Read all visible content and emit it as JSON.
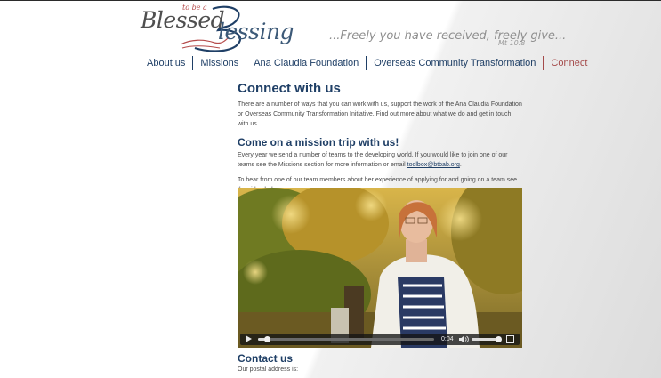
{
  "logo": {
    "word1": "Blessed",
    "small": "to be a",
    "word2": "lessing"
  },
  "tagline": {
    "text": "...Freely you have received, freely give...",
    "reference": "Mt 10.8"
  },
  "nav": {
    "items": [
      {
        "label": "About us"
      },
      {
        "label": "Missions"
      },
      {
        "label": "Ana Claudia Foundation"
      },
      {
        "label": "Overseas Community Transformation"
      },
      {
        "label": "Connect"
      }
    ],
    "active": "Connect"
  },
  "main": {
    "heading": "Connect with us",
    "intro": "There are a number of ways that you can work with us, support the work of the Ana Claudia Foundation or Overseas Community Transformation Initiative. Find out more about what we do and get in touch with us.",
    "mission_heading": "Come on a mission trip with us!",
    "mission_text": "Every year we send a number of teams to the developing world. If you would like to join one of our teams see the Missions section for more information or email",
    "mission_email": "toolbox@btbab.org",
    "mission_text_end": ".",
    "video_intro": "To hear from one of our team members about her experience of applying for and going on a team see the video below."
  },
  "video": {
    "time": "0:04",
    "progress": 0.04,
    "volume": 0.9
  },
  "contact": {
    "heading": "Contact us",
    "postal_label": "Our postal address is:"
  },
  "colors": {
    "brand_blue": "#1f3f66",
    "accent_red": "#a44a4a",
    "body_text": "#4a4a4a"
  }
}
